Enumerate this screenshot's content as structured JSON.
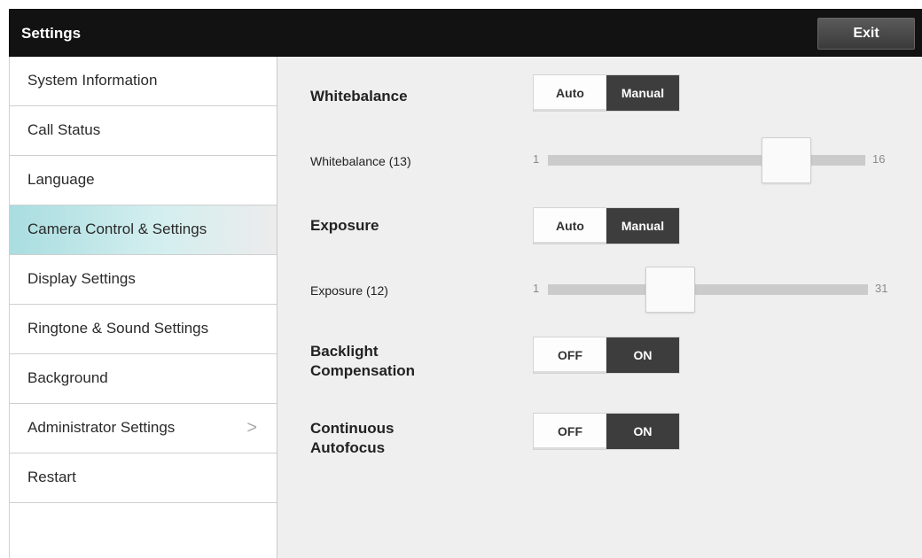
{
  "header": {
    "title": "Settings",
    "exit_label": "Exit"
  },
  "sidebar": {
    "active_index": 3,
    "items": [
      {
        "label": "System Information"
      },
      {
        "label": "Call Status"
      },
      {
        "label": "Language"
      },
      {
        "label": "Camera Control & Settings"
      },
      {
        "label": "Display Settings"
      },
      {
        "label": "Ringtone & Sound Settings"
      },
      {
        "label": "Background"
      },
      {
        "label": "Administrator Settings",
        "chevron": ">"
      },
      {
        "label": "Restart"
      }
    ]
  },
  "main": {
    "whitebalance": {
      "label": "Whitebalance",
      "options": [
        "Auto",
        "Manual"
      ],
      "selected": "Manual",
      "slider": {
        "label": "Whitebalance (13)",
        "min": "1",
        "max": "16",
        "value": 13
      }
    },
    "exposure": {
      "label": "Exposure",
      "options": [
        "Auto",
        "Manual"
      ],
      "selected": "Manual",
      "slider": {
        "label": "Exposure (12)",
        "min": "1",
        "max": "31",
        "value": 12
      }
    },
    "backlight": {
      "label_line1": "Backlight",
      "label_line2": "Compensation",
      "options": [
        "OFF",
        "ON"
      ],
      "selected": "ON"
    },
    "autofocus": {
      "label_line1": "Continuous",
      "label_line2": "Autofocus",
      "options": [
        "OFF",
        "ON"
      ],
      "selected": "ON"
    }
  },
  "colors": {
    "titlebar": "#121212",
    "active_item": "#a9dde0",
    "toggle_selected": "#3d3d3d",
    "content_bg": "#efefef"
  }
}
